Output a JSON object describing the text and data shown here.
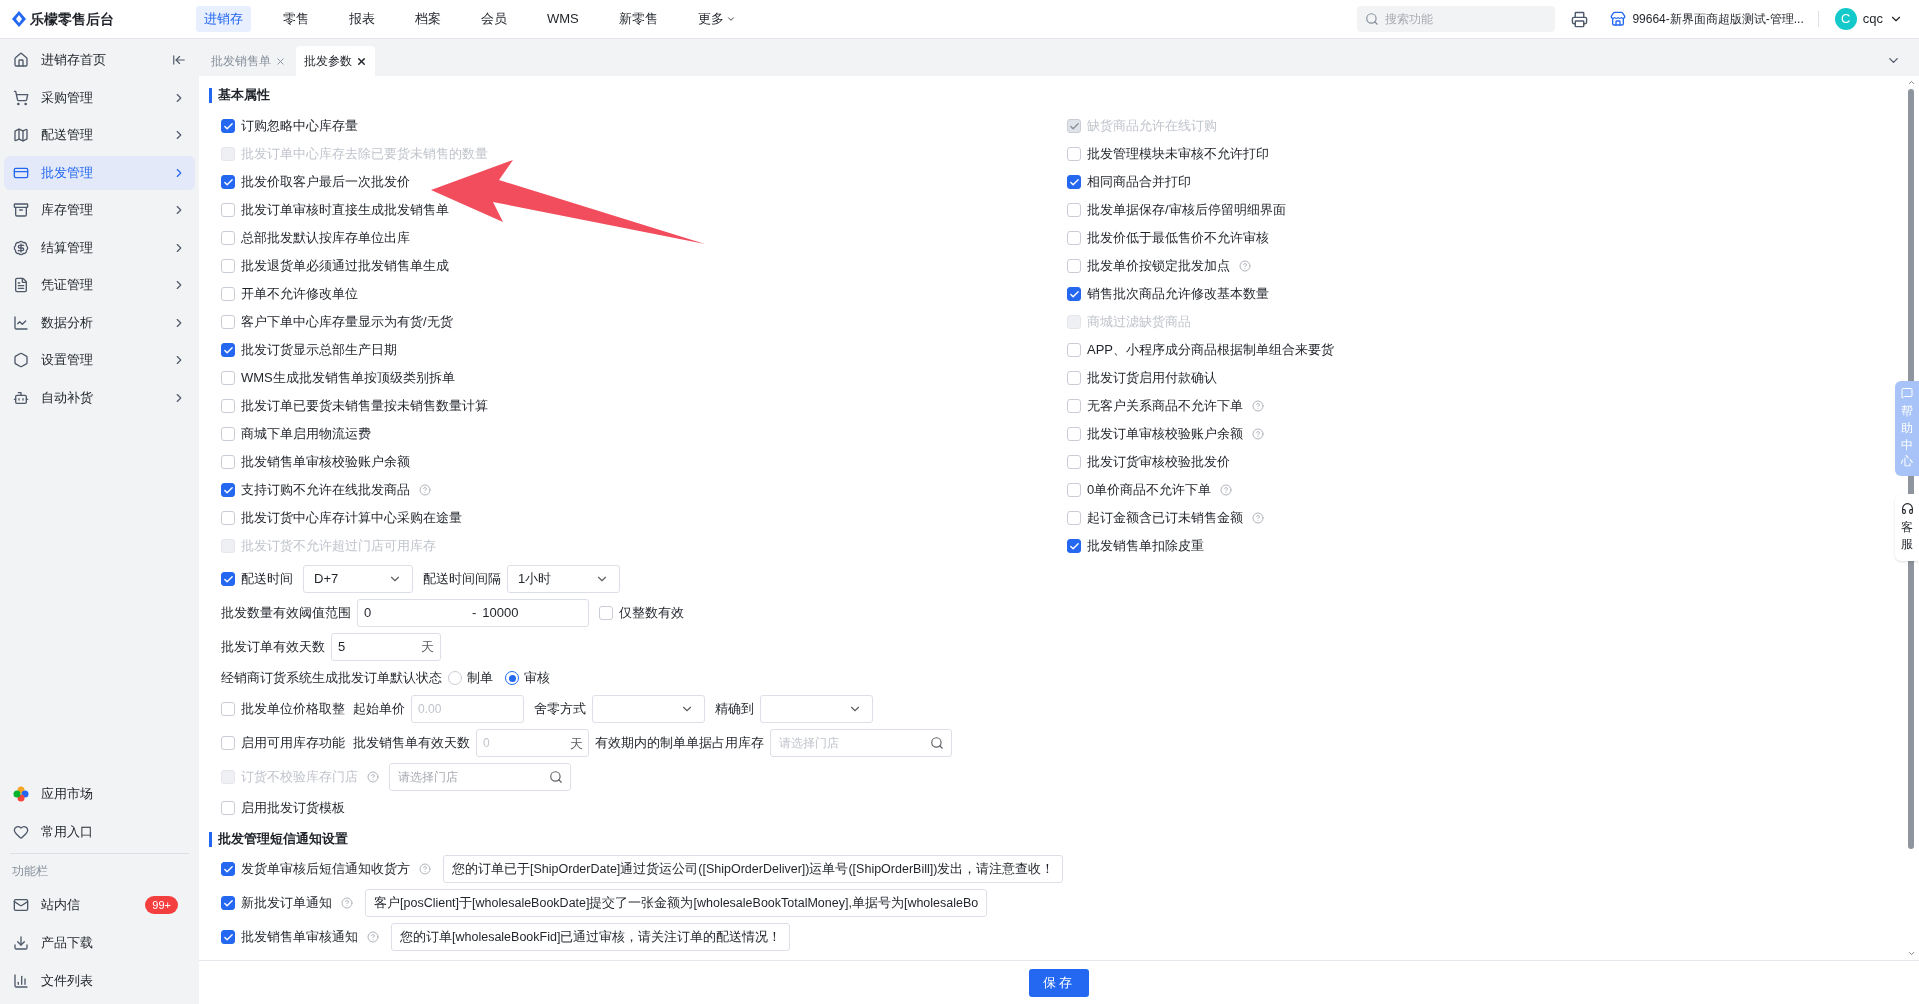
{
  "app": {
    "title": "乐檬零售后台"
  },
  "nav": [
    {
      "label": "进销存",
      "selected": true
    },
    {
      "label": "零售",
      "selected": false
    },
    {
      "label": "报表",
      "selected": false
    },
    {
      "label": "档案",
      "selected": false
    },
    {
      "label": "会员",
      "selected": false
    },
    {
      "label": "WMS",
      "selected": false
    },
    {
      "label": "新零售",
      "selected": false
    },
    {
      "label": "更多",
      "selected": false,
      "dropdown": true
    }
  ],
  "search": {
    "placeholder": "搜索功能"
  },
  "store": "99664-新界面商超版测试-管理...",
  "user": {
    "initial": "C",
    "name": "cqc"
  },
  "sidebar": {
    "items": [
      {
        "label": "进销存首页",
        "selected": false,
        "kind": "collapse"
      },
      {
        "label": "采购管理",
        "selected": false,
        "kind": "menu"
      },
      {
        "label": "配送管理",
        "selected": false,
        "kind": "menu"
      },
      {
        "label": "批发管理",
        "selected": true,
        "kind": "menu"
      },
      {
        "label": "库存管理",
        "selected": false,
        "kind": "menu"
      },
      {
        "label": "结算管理",
        "selected": false,
        "kind": "menu"
      },
      {
        "label": "凭证管理",
        "selected": false,
        "kind": "menu"
      },
      {
        "label": "数据分析",
        "selected": false,
        "kind": "menu"
      },
      {
        "label": "设置管理",
        "selected": false,
        "kind": "menu"
      },
      {
        "label": "自动补货",
        "selected": false,
        "kind": "menu"
      }
    ],
    "bottom": [
      {
        "label": "应用市场"
      },
      {
        "label": "常用入口"
      }
    ],
    "section_title": "功能栏",
    "tools": [
      {
        "label": "站内信",
        "badge": "99+"
      },
      {
        "label": "产品下载"
      },
      {
        "label": "文件列表"
      }
    ]
  },
  "tabs": [
    {
      "label": "批发销售单",
      "selected": false
    },
    {
      "label": "批发参数",
      "selected": true
    }
  ],
  "basic": {
    "title": "基本属性",
    "left": [
      {
        "label": "订购忽略中心库存量",
        "checked": true,
        "disabled": false,
        "help": false
      },
      {
        "label": "批发订单中心库存去除已要货未销售的数量",
        "checked": false,
        "disabled": true,
        "help": false
      },
      {
        "label": "批发价取客户最后一次批发价",
        "checked": true,
        "disabled": false,
        "help": false
      },
      {
        "label": "批发订单审核时直接生成批发销售单",
        "checked": false,
        "disabled": false,
        "help": false
      },
      {
        "label": "总部批发默认按库存单位出库",
        "checked": false,
        "disabled": false,
        "help": false
      },
      {
        "label": "批发退货单必须通过批发销售单生成",
        "checked": false,
        "disabled": false,
        "help": false
      },
      {
        "label": "开单不允许修改单位",
        "checked": false,
        "disabled": false,
        "help": false
      },
      {
        "label": "客户下单中心库存量显示为有货/无货",
        "checked": false,
        "disabled": false,
        "help": false
      },
      {
        "label": "批发订货显示总部生产日期",
        "checked": true,
        "disabled": false,
        "help": false
      },
      {
        "label": "WMS生成批发销售单按顶级类别拆单",
        "checked": false,
        "disabled": false,
        "help": false
      },
      {
        "label": "批发订单已要货未销售量按未销售数量计算",
        "checked": false,
        "disabled": false,
        "help": false
      },
      {
        "label": "商城下单启用物流运费",
        "checked": false,
        "disabled": false,
        "help": false
      },
      {
        "label": "批发销售单审核校验账户余额",
        "checked": false,
        "disabled": false,
        "help": false
      },
      {
        "label": "支持订购不允许在线批发商品",
        "checked": true,
        "disabled": false,
        "help": true
      },
      {
        "label": "批发订货中心库存计算中心采购在途量",
        "checked": false,
        "disabled": false,
        "help": false
      },
      {
        "label": "批发订货不允许超过门店可用库存",
        "checked": false,
        "disabled": true,
        "help": false
      }
    ],
    "right": [
      {
        "label": "缺货商品允许在线订购",
        "checked": true,
        "disabled": true,
        "help": false
      },
      {
        "label": "批发管理模块未审核不允许打印",
        "checked": false,
        "disabled": false,
        "help": false
      },
      {
        "label": "相同商品合并打印",
        "checked": true,
        "disabled": false,
        "help": false
      },
      {
        "label": "批发单据保存/审核后停留明细界面",
        "checked": false,
        "disabled": false,
        "help": false
      },
      {
        "label": "批发价低于最低售价不允许审核",
        "checked": false,
        "disabled": false,
        "help": false
      },
      {
        "label": "批发单价按锁定批发加点",
        "checked": false,
        "disabled": false,
        "help": true
      },
      {
        "label": "销售批次商品允许修改基本数量",
        "checked": true,
        "disabled": false,
        "help": false
      },
      {
        "label": "商城过滤缺货商品",
        "checked": false,
        "disabled": true,
        "help": false
      },
      {
        "label": "APP、小程序成分商品根据制单组合来要货",
        "checked": false,
        "disabled": false,
        "help": false
      },
      {
        "label": "批发订货启用付款确认",
        "checked": false,
        "disabled": false,
        "help": false
      },
      {
        "label": "无客户关系商品不允许下单",
        "checked": false,
        "disabled": false,
        "help": true
      },
      {
        "label": "批发订单审核校验账户余额",
        "checked": false,
        "disabled": false,
        "help": true
      },
      {
        "label": "批发订货审核校验批发价",
        "checked": false,
        "disabled": false,
        "help": false
      },
      {
        "label": "0单价商品不允许下单",
        "checked": false,
        "disabled": false,
        "help": true
      },
      {
        "label": "起订金额含已订未销售金额",
        "checked": false,
        "disabled": false,
        "help": true
      },
      {
        "label": "批发销售单扣除皮重",
        "checked": true,
        "disabled": false,
        "help": false
      }
    ]
  },
  "delivery": {
    "checked": true,
    "label": "配送时间",
    "value": "D+7",
    "interval_label": "配送时间间隔",
    "interval_value": "1小时"
  },
  "quantity_range": {
    "label": "批发数量有效阈值范围",
    "min": "0",
    "separator": "-",
    "max": "10000",
    "integer_only": {
      "label": "仅整数有效",
      "checked": false
    }
  },
  "order_valid_days": {
    "label": "批发订单有效天数",
    "value": "5",
    "unit": "天"
  },
  "default_status": {
    "label": "经销商订货系统生成批发订单默认状态",
    "options": [
      {
        "label": "制单",
        "selected": false
      },
      {
        "label": "审核",
        "selected": true
      }
    ]
  },
  "price_rounding": {
    "checked": false,
    "label": "批发单位价格取整",
    "start_label": "起始单价",
    "start_placeholder": "0.00",
    "mode_label": "舍零方式",
    "precision_label": "精确到"
  },
  "available_stock": {
    "checked": false,
    "label": "启用可用库存功能",
    "days_label": "批发销售单有效天数",
    "days_placeholder": "0",
    "unit": "天",
    "store_label": "有效期内的制单单据占用库存",
    "store_placeholder": "请选择门店"
  },
  "skip_stock_check": {
    "checked": false,
    "disabled": true,
    "help": true,
    "label": "订货不校验库存门店",
    "store_placeholder": "请选择门店"
  },
  "order_template": {
    "checked": false,
    "label": "启用批发订货模板"
  },
  "sms": {
    "title": "批发管理短信通知设置",
    "items": [
      {
        "label": "发货单审核后短信通知收货方",
        "checked": true,
        "help": true,
        "value": "您的订单已于[ShipOrderDate]通过货运公司([ShipOrderDeliver])运单号([ShipOrderBill])发出，请注意查收！"
      },
      {
        "label": "新批发订单通知",
        "checked": true,
        "help": true,
        "value": "客户[posClient]于[wholesaleBookDate]提交了一张金额为[wholesaleBookTotalMoney],单据号为[wholesaleBo"
      },
      {
        "label": "批发销售单审核通知",
        "checked": true,
        "help": true,
        "value": "您的订单[wholesaleBookFid]已通过审核，请关注订单的配送情况！"
      }
    ]
  },
  "save": "保存",
  "float": {
    "help": "帮助中心",
    "service": "客服"
  }
}
